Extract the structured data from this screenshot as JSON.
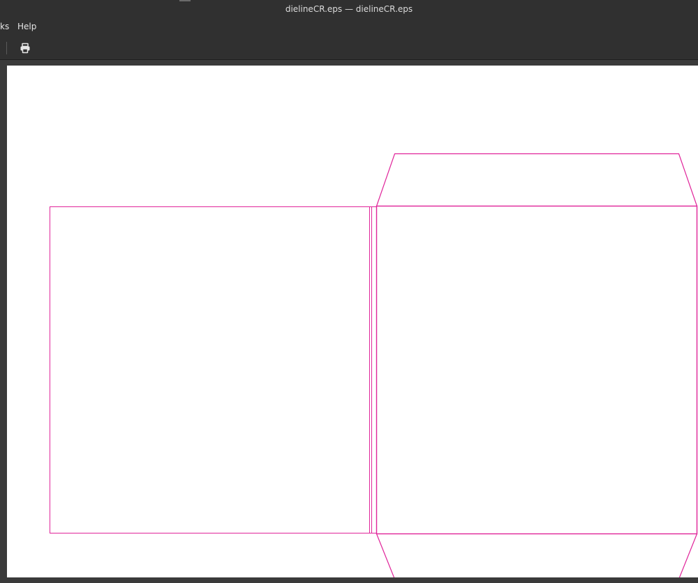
{
  "window": {
    "title": "dielineCR.eps — dielineCR.eps"
  },
  "menubar": {
    "items": [
      "ks",
      "Help"
    ]
  },
  "toolbar": {
    "print_icon": "printer-icon"
  },
  "document": {
    "background": "#ffffff",
    "line_color": "#e0249a"
  }
}
